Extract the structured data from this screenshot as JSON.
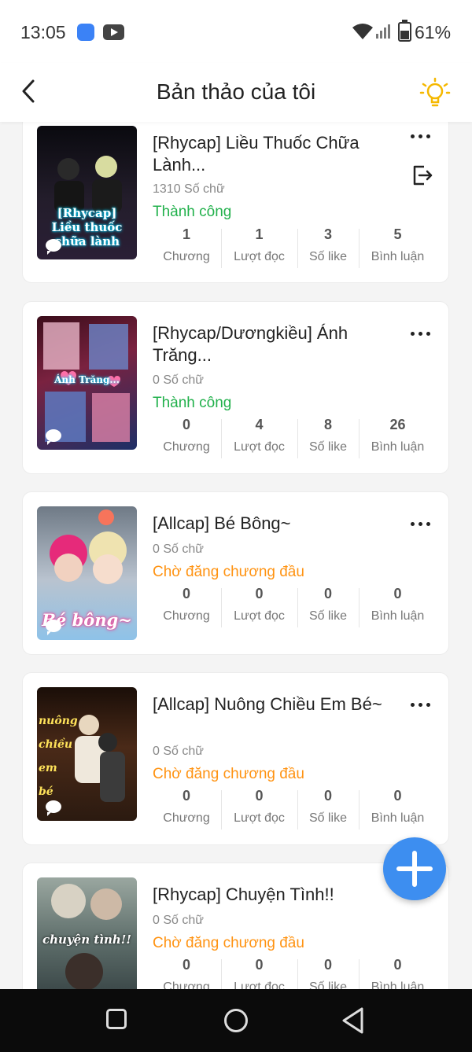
{
  "status_bar": {
    "time": "13:05",
    "battery": "61%"
  },
  "header": {
    "title": "Bản thảo của tôi"
  },
  "stat_labels": {
    "chapters": "Chương",
    "reads": "Lượt đọc",
    "likes": "Số like",
    "comments": "Bình luận"
  },
  "stories": [
    {
      "title": "[Rhycap] Liều Thuốc Chữa Lành...",
      "words": "1310 Số chữ",
      "status": "Thành công",
      "status_color": "#22b14c",
      "chapters": "1",
      "reads": "1",
      "likes": "3",
      "comments": "5",
      "cover_text": "[Rhycap] Liều thuốc chữa lành"
    },
    {
      "title": "[Rhycap/Dươngkiều] Ánh Trăng...",
      "words": "0 Số chữ",
      "status": "Thành công",
      "status_color": "#22b14c",
      "chapters": "0",
      "reads": "4",
      "likes": "8",
      "comments": "26",
      "cover_text": "Ánh Trăng..."
    },
    {
      "title": "[Allcap] Bé Bông~",
      "words": "0 Số chữ",
      "status": "Chờ đăng chương đầu",
      "status_color": "#ff9312",
      "chapters": "0",
      "reads": "0",
      "likes": "0",
      "comments": "0",
      "cover_text": "Bé bông~"
    },
    {
      "title": "[Allcap] Nuông Chiều Em Bé~",
      "words": "0 Số chữ",
      "status": "Chờ đăng chương đầu",
      "status_color": "#ff9312",
      "chapters": "0",
      "reads": "0",
      "likes": "0",
      "comments": "0",
      "cover_text": "nuông chiều em bé"
    },
    {
      "title": "[Rhycap] Chuyện Tình!!",
      "words": "0 Số chữ",
      "status": "Chờ đăng chương đầu",
      "status_color": "#ff9312",
      "chapters": "0",
      "reads": "0",
      "likes": "0",
      "comments": "0",
      "cover_text": "chuyện tình!!"
    }
  ]
}
